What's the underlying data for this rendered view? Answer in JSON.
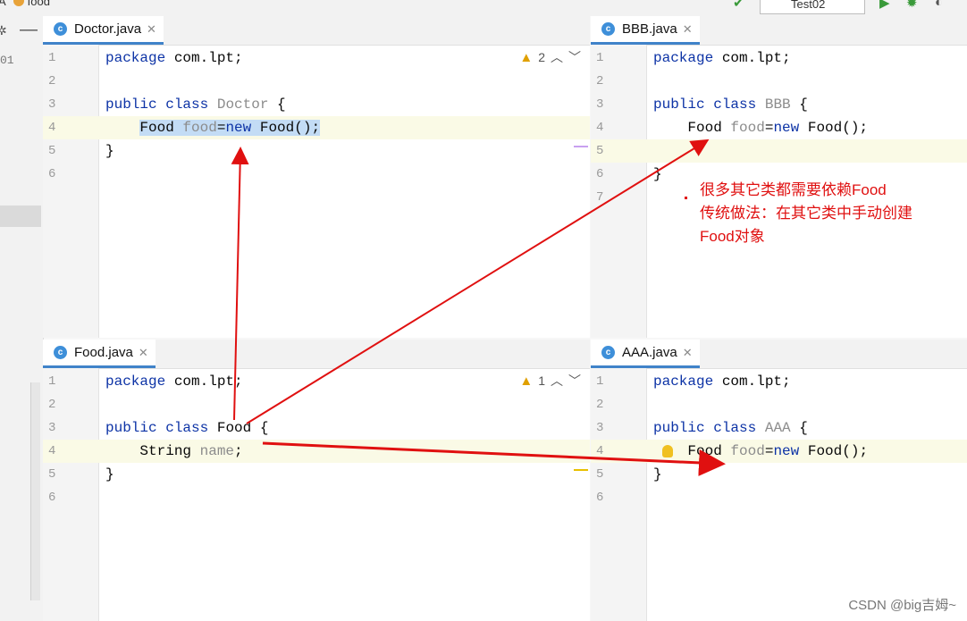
{
  "top_bar": {
    "crumb_left": "A",
    "crumb_file": "food",
    "run_config": "Test02"
  },
  "left_strip": {
    "line_hint": "01"
  },
  "panes": {
    "doctor": {
      "tab": "Doctor.java",
      "warning_count": "2",
      "lines": [
        {
          "n": "1",
          "tokens": [
            {
              "t": "package",
              "c": "kw"
            },
            {
              "t": " com.lpt;"
            }
          ]
        },
        {
          "n": "2",
          "tokens": []
        },
        {
          "n": "3",
          "tokens": [
            {
              "t": "public",
              "c": "kw"
            },
            {
              "t": " "
            },
            {
              "t": "class",
              "c": "kw"
            },
            {
              "t": " "
            },
            {
              "t": "Doctor",
              "c": "gray"
            },
            {
              "t": " {"
            }
          ]
        },
        {
          "n": "4",
          "hl": true,
          "tokens": [
            {
              "t": "    "
            },
            {
              "t": "Food ",
              "c": "sel"
            },
            {
              "t": "food",
              "c": "sel gray"
            },
            {
              "t": "=",
              "c": "sel"
            },
            {
              "t": "new",
              "c": "sel kw"
            },
            {
              "t": " Food();",
              "c": "sel"
            }
          ]
        },
        {
          "n": "5",
          "tokens": [
            {
              "t": "}"
            }
          ]
        },
        {
          "n": "6",
          "tokens": []
        }
      ]
    },
    "bbb": {
      "tab": "BBB.java",
      "lines": [
        {
          "n": "1",
          "tokens": [
            {
              "t": "package",
              "c": "kw"
            },
            {
              "t": " com.lpt;"
            }
          ]
        },
        {
          "n": "2",
          "tokens": []
        },
        {
          "n": "3",
          "tokens": [
            {
              "t": "public",
              "c": "kw"
            },
            {
              "t": " "
            },
            {
              "t": "class",
              "c": "kw"
            },
            {
              "t": " "
            },
            {
              "t": "BBB",
              "c": "gray"
            },
            {
              "t": " {"
            }
          ]
        },
        {
          "n": "4",
          "tokens": [
            {
              "t": "    Food "
            },
            {
              "t": "food",
              "c": "gray"
            },
            {
              "t": "="
            },
            {
              "t": "new",
              "c": "kw"
            },
            {
              "t": " Food();"
            }
          ]
        },
        {
          "n": "5",
          "hl": true,
          "tokens": []
        },
        {
          "n": "6",
          "tokens": [
            {
              "t": "}"
            }
          ]
        },
        {
          "n": "7",
          "tokens": []
        }
      ]
    },
    "food": {
      "tab": "Food.java",
      "warning_count": "1",
      "lines": [
        {
          "n": "1",
          "tokens": [
            {
              "t": "package",
              "c": "kw"
            },
            {
              "t": " com.lpt;"
            }
          ]
        },
        {
          "n": "2",
          "tokens": []
        },
        {
          "n": "3",
          "tokens": [
            {
              "t": "public",
              "c": "kw"
            },
            {
              "t": " "
            },
            {
              "t": "class",
              "c": "kw"
            },
            {
              "t": " Food {"
            }
          ]
        },
        {
          "n": "4",
          "hl": true,
          "tokens": [
            {
              "t": "    String "
            },
            {
              "t": "name",
              "c": "gray"
            },
            {
              "t": ";"
            }
          ]
        },
        {
          "n": "5",
          "tokens": [
            {
              "t": "}"
            }
          ]
        },
        {
          "n": "6",
          "tokens": []
        }
      ]
    },
    "aaa": {
      "tab": "AAA.java",
      "lines": [
        {
          "n": "1",
          "tokens": [
            {
              "t": "package",
              "c": "kw"
            },
            {
              "t": " com.lpt;"
            }
          ]
        },
        {
          "n": "2",
          "tokens": []
        },
        {
          "n": "3",
          "tokens": [
            {
              "t": "public",
              "c": "kw"
            },
            {
              "t": " "
            },
            {
              "t": "class",
              "c": "kw"
            },
            {
              "t": " "
            },
            {
              "t": "AAA",
              "c": "gray"
            },
            {
              "t": " {"
            }
          ]
        },
        {
          "n": "4",
          "hl": true,
          "bulb": true,
          "tokens": [
            {
              "t": "    Food "
            },
            {
              "t": "food",
              "c": "gray"
            },
            {
              "t": "="
            },
            {
              "t": "new",
              "c": "kw"
            },
            {
              "t": " Food();"
            }
          ]
        },
        {
          "n": "5",
          "tokens": [
            {
              "t": "}"
            }
          ]
        },
        {
          "n": "6",
          "tokens": []
        }
      ]
    }
  },
  "annotation": {
    "text": "很多其它类都需要依赖Food\n传统做法：在其它类中手动创建\nFood对象"
  },
  "watermark": "CSDN @big吉姆~",
  "colors": {
    "keyword": "#0d33a6",
    "arrow": "#e01010",
    "tab_underline": "#4083c9",
    "selection": "#c3dcf5"
  }
}
